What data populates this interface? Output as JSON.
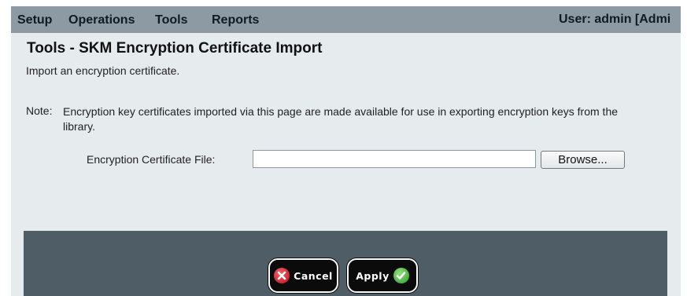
{
  "menu": {
    "items": [
      "Setup",
      "Operations",
      "Tools",
      "Reports"
    ],
    "user": "User: admin [Admi"
  },
  "page": {
    "title": "Tools - SKM Encryption Certificate Import",
    "description": "Import an encryption certificate.",
    "note_label": "Note:",
    "note_text": "Encryption key certificates imported via this page are made available for use in exporting encryption keys from the library."
  },
  "form": {
    "field_label": "Encryption Certificate File:",
    "file_value": "",
    "browse_label": "Browse..."
  },
  "footer": {
    "cancel_label": "Cancel",
    "apply_label": "Apply"
  },
  "icons": {
    "cancel": "x-circle-icon",
    "apply": "check-circle-icon"
  },
  "colors": {
    "menubar": "#8d9aa3",
    "panel": "#e6ebee",
    "footer": "#4f5d66",
    "cancel_icon": "#d1202b",
    "apply_icon": "#43b336"
  }
}
